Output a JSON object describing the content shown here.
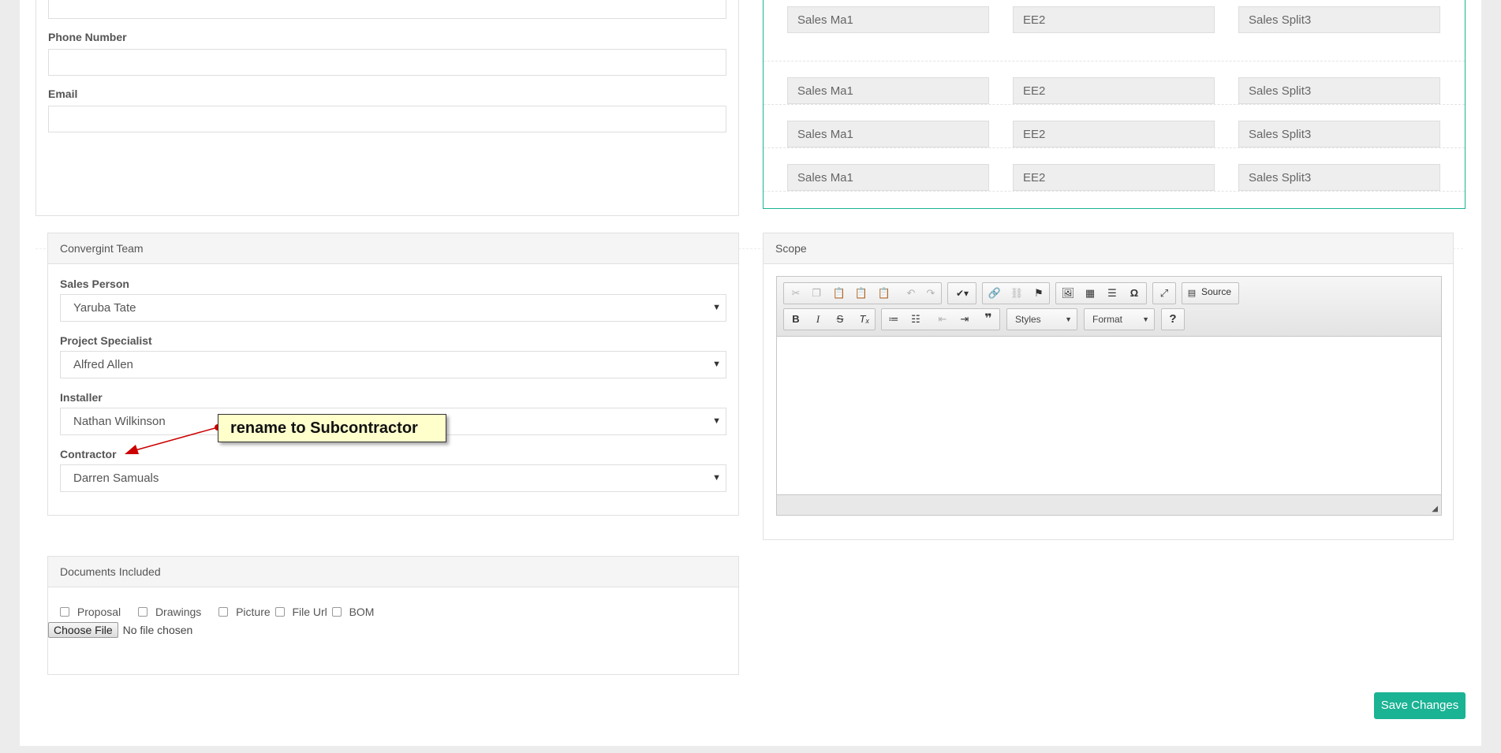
{
  "contact": {
    "phone_label": "Phone Number",
    "phone_value": "",
    "email_label": "Email",
    "email_value": ""
  },
  "sales_splits": {
    "rows": [
      [
        "Sales Ma1",
        "EE2",
        "Sales Split3"
      ],
      [
        "Sales Ma1",
        "EE2",
        "Sales Split3"
      ],
      [
        "Sales Ma1",
        "EE2",
        "Sales Split3"
      ],
      [
        "Sales Ma1",
        "EE2",
        "Sales Split3"
      ]
    ]
  },
  "team": {
    "heading": "Convergint Team",
    "sales_person_label": "Sales Person",
    "sales_person_value": "Yaruba Tate",
    "project_specialist_label": "Project Specialist",
    "project_specialist_value": "Alfred Allen",
    "installer_label": "Installer",
    "installer_value": "Nathan Wilkinson",
    "contractor_label": "Contractor",
    "contractor_value": "Darren Samuals"
  },
  "scope": {
    "heading": "Scope",
    "source_label": "Source",
    "styles_label": "Styles",
    "format_label": "Format",
    "help_label": "?"
  },
  "documents": {
    "heading": "Documents Included",
    "options": [
      "Proposal",
      "Drawings",
      "Picture",
      "File Url",
      "BOM"
    ],
    "choose_file_label": "Choose File",
    "no_file_text": "No file chosen"
  },
  "actions": {
    "save_label": "Save Changes"
  },
  "annotation": {
    "callout_text": "rename to Subcontractor",
    "arrow_color": "#cc0000"
  },
  "colors": {
    "accent": "#1ab394",
    "callout_bg": "#ffffcc"
  }
}
